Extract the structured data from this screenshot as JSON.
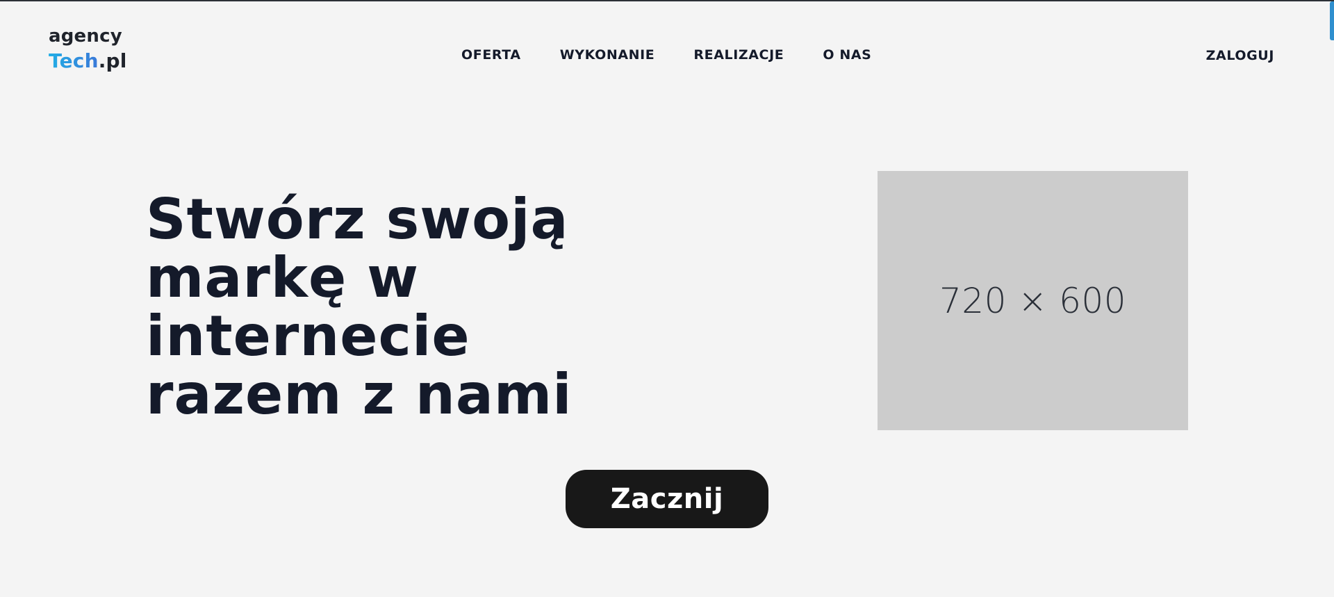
{
  "logo": {
    "line1": "agency",
    "tech": "Tech",
    "domain": ".pl"
  },
  "nav": {
    "items": [
      {
        "label": "OFERTA"
      },
      {
        "label": "WYKONANIE"
      },
      {
        "label": "REALIZACJE"
      },
      {
        "label": "O NAS"
      }
    ],
    "login": "ZALOGUJ"
  },
  "hero": {
    "title_lines": [
      "Stwórz swoją",
      "markę w",
      "internecie",
      "razem z nami"
    ],
    "image_placeholder": "720 × 600",
    "cta_label": "Zacznij"
  },
  "colors": {
    "background": "#f4f4f4",
    "text": "#141a2a",
    "accent_start": "#22aee6",
    "accent_end": "#3a78d8",
    "cta_background": "#181818",
    "placeholder": "#cccccc"
  }
}
